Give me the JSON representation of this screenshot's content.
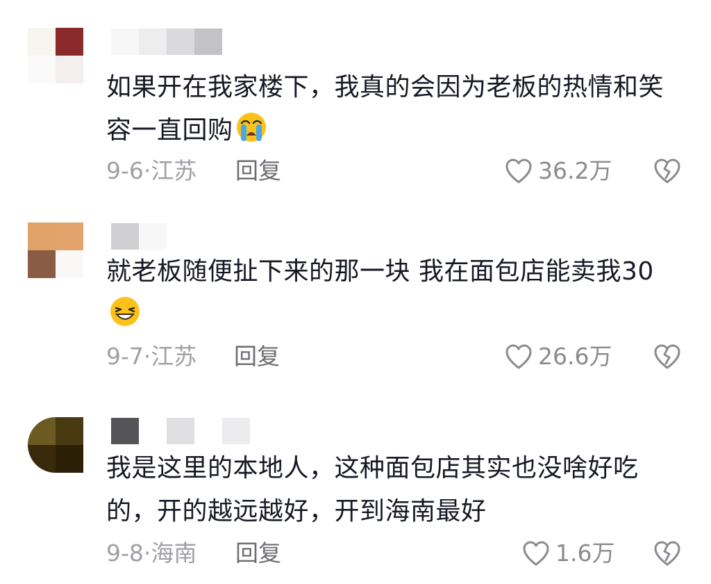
{
  "comments": [
    {
      "text_line1": "如果开在我家楼下，我真的会因为老板的热情和笑",
      "text_line2": "容一直回购",
      "emoji": "loudly-crying-face",
      "date": "9-6",
      "location": "江苏",
      "reply_label": "回复",
      "likes": "36.2万"
    },
    {
      "text_line1": "就老板随便扯下来的那一块 我在面包店能卖我30",
      "text_line2": "",
      "emoji": "grinning-squinting-face",
      "date": "9-7",
      "location": "江苏",
      "reply_label": "回复",
      "likes": "26.6万"
    },
    {
      "text_line1": "我是这里的本地人，这种面包店其实也没啥好吃",
      "text_line2": "的，开的越远越好，开到海南最好",
      "emoji": "",
      "date": "9-8",
      "location": "海南",
      "reply_label": "回复",
      "likes": "1.6万"
    }
  ],
  "colors": {
    "text": "#161823",
    "meta": "#a0a0a5",
    "reply": "#6c6c72",
    "icon": "#8a8a90"
  },
  "icons": {
    "like": "heart-outline-icon",
    "dislike": "broken-heart-icon"
  }
}
